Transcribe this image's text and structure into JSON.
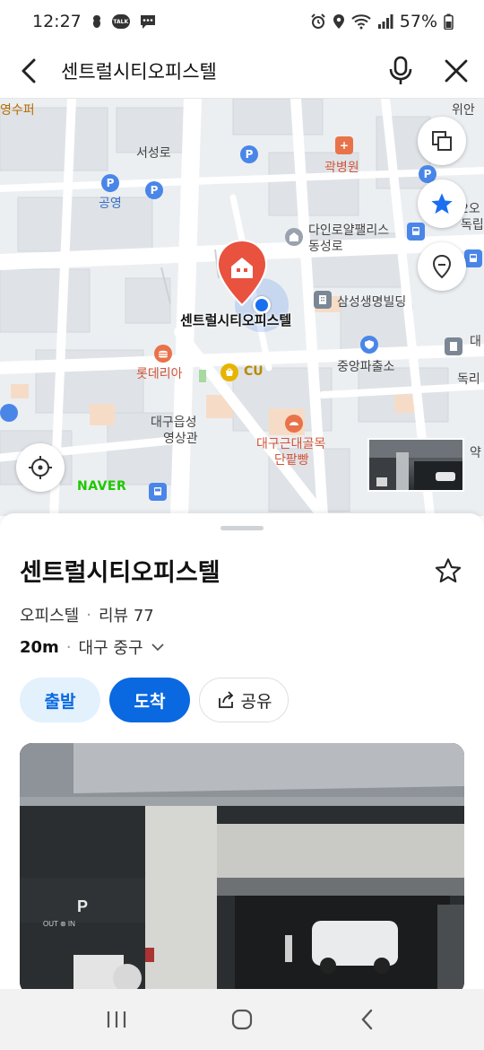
{
  "status": {
    "time": "12:27",
    "talk_badge": "TALK",
    "battery": "57%"
  },
  "search": {
    "query": "센트럴시티오피스텔"
  },
  "map": {
    "pois": {
      "yeongsu": "영수퍼",
      "wian": "위안",
      "seoseongro": "서성로",
      "gwak_hospital": "곽병원",
      "parking_gongyeong": "공영",
      "dainro_1": "다인로얄팰리스",
      "dainro_2": "동성로",
      "samsung": "삼성생명빌딩",
      "right_edge_1": "2오",
      "right_edge_2": "독립",
      "right_edge_3": "대",
      "right_edge_4": "독리",
      "marker_label": "센트럴시티오피스텔",
      "lotteria": "롯데리아",
      "cu": "CU",
      "jungang_police": "중앙파출소",
      "daegu_studio_1": "대구읍성",
      "daegu_studio_2": "영상관",
      "bakery_1": "대구근대골목",
      "bakery_2": "단팥빵",
      "right_edge_5": "약",
      "parking_p": "P",
      "hospital_plus": "+"
    },
    "naver_logo": "NAVER"
  },
  "place": {
    "name": "센트럴시티오피스텔",
    "category": "오피스텔",
    "review_label": "리뷰 77",
    "distance": "20m",
    "region": "대구 중구",
    "buttons": {
      "depart": "출발",
      "arrive": "도착",
      "share": "공유"
    },
    "photo_sign": "P",
    "photo_sign_sub": "OUT ⊗ IN"
  },
  "colors": {
    "accent_blue": "#0a68e0",
    "light_blue": "#e3f1fd",
    "marker_red": "#e8523f",
    "naver_green": "#1ec800",
    "poi_blue": "#4a86e8",
    "poi_orange": "#e8734a"
  }
}
